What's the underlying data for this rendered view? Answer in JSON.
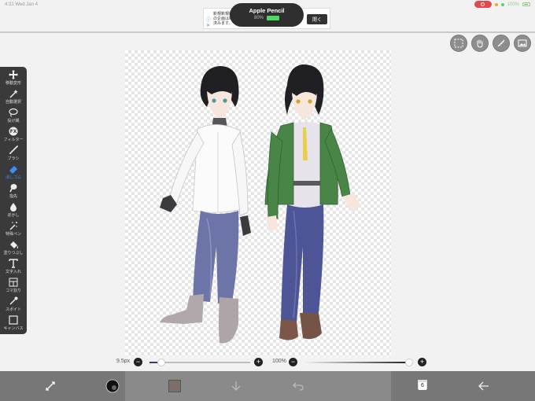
{
  "status_bar": {
    "time": "4:31 Wed Jan 4",
    "battery": "100%"
  },
  "ad": {
    "text_line1": "新規新規新規新規新規",
    "text_line2": "の企画は新規新規新規",
    "text_line3": "済みます。",
    "open_button": "開く"
  },
  "pencil": {
    "title": "Apple Pencil",
    "percent": "80%"
  },
  "top_tools": [
    {
      "name": "selection-icon"
    },
    {
      "name": "hand-icon"
    },
    {
      "name": "ruler-icon"
    },
    {
      "name": "material-icon"
    }
  ],
  "left_toolbar": {
    "items": [
      {
        "label": "移動変形"
      },
      {
        "label": "自動選択"
      },
      {
        "label": "投げ縄"
      },
      {
        "label": "フィルター"
      },
      {
        "label": "ブラシ"
      },
      {
        "label": "消しゴム"
      },
      {
        "label": "指先"
      },
      {
        "label": "ぼかし"
      },
      {
        "label": "特殊ペン"
      },
      {
        "label": "塗りつぶし"
      },
      {
        "label": "文字入れ"
      },
      {
        "label": "コマ割り"
      },
      {
        "label": "スポイト"
      },
      {
        "label": "キャンバス"
      }
    ],
    "active_index": 5,
    "active_color": "#3d8ef8"
  },
  "brush": {
    "size_label": "9.5px",
    "size_fraction": 0.12
  },
  "opacity": {
    "label": "100%",
    "fraction": 1.0
  },
  "bottom_bar": {
    "layers_count": "6",
    "current_color": "#7b6e6c"
  },
  "colors": {
    "toolbar_bg": "#3a3a3a",
    "bottom_bar_bg": "#777777",
    "accent": "#3d8ef8"
  }
}
